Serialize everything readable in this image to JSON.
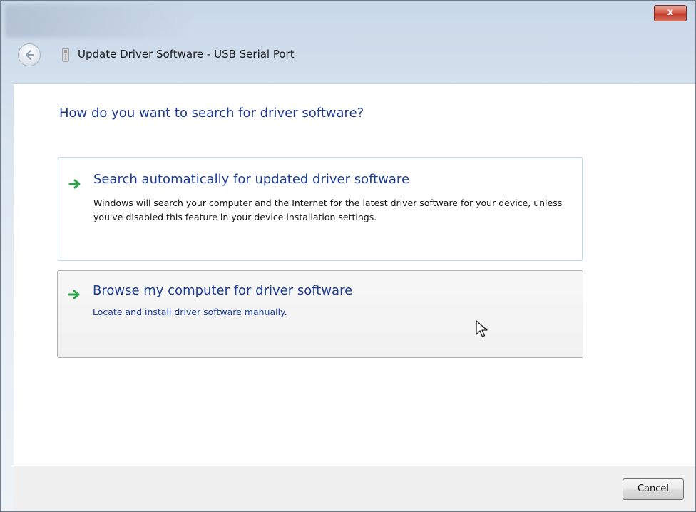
{
  "window": {
    "title": "Update Driver Software - USB Serial Port",
    "close_label": "x"
  },
  "content": {
    "question": "How do you want to search for driver software?"
  },
  "options": [
    {
      "title": "Search automatically for updated driver software",
      "description": "Windows will search your computer and the Internet for the latest driver software for your device, unless you've disabled this feature in your device installation settings."
    },
    {
      "title": "Browse my computer for driver software",
      "description": "Locate and install driver software manually."
    }
  ],
  "footer": {
    "cancel_label": "Cancel"
  },
  "icons": {
    "back": "back-arrow-icon",
    "device": "usb-device-icon",
    "option_arrow": "green-arrow-icon",
    "cursor": "mouse-pointer-icon"
  },
  "colors": {
    "heading": "#1e3a8a",
    "link": "#1a3c97",
    "arrow": "#2ea34a",
    "close": "#c0392b"
  }
}
